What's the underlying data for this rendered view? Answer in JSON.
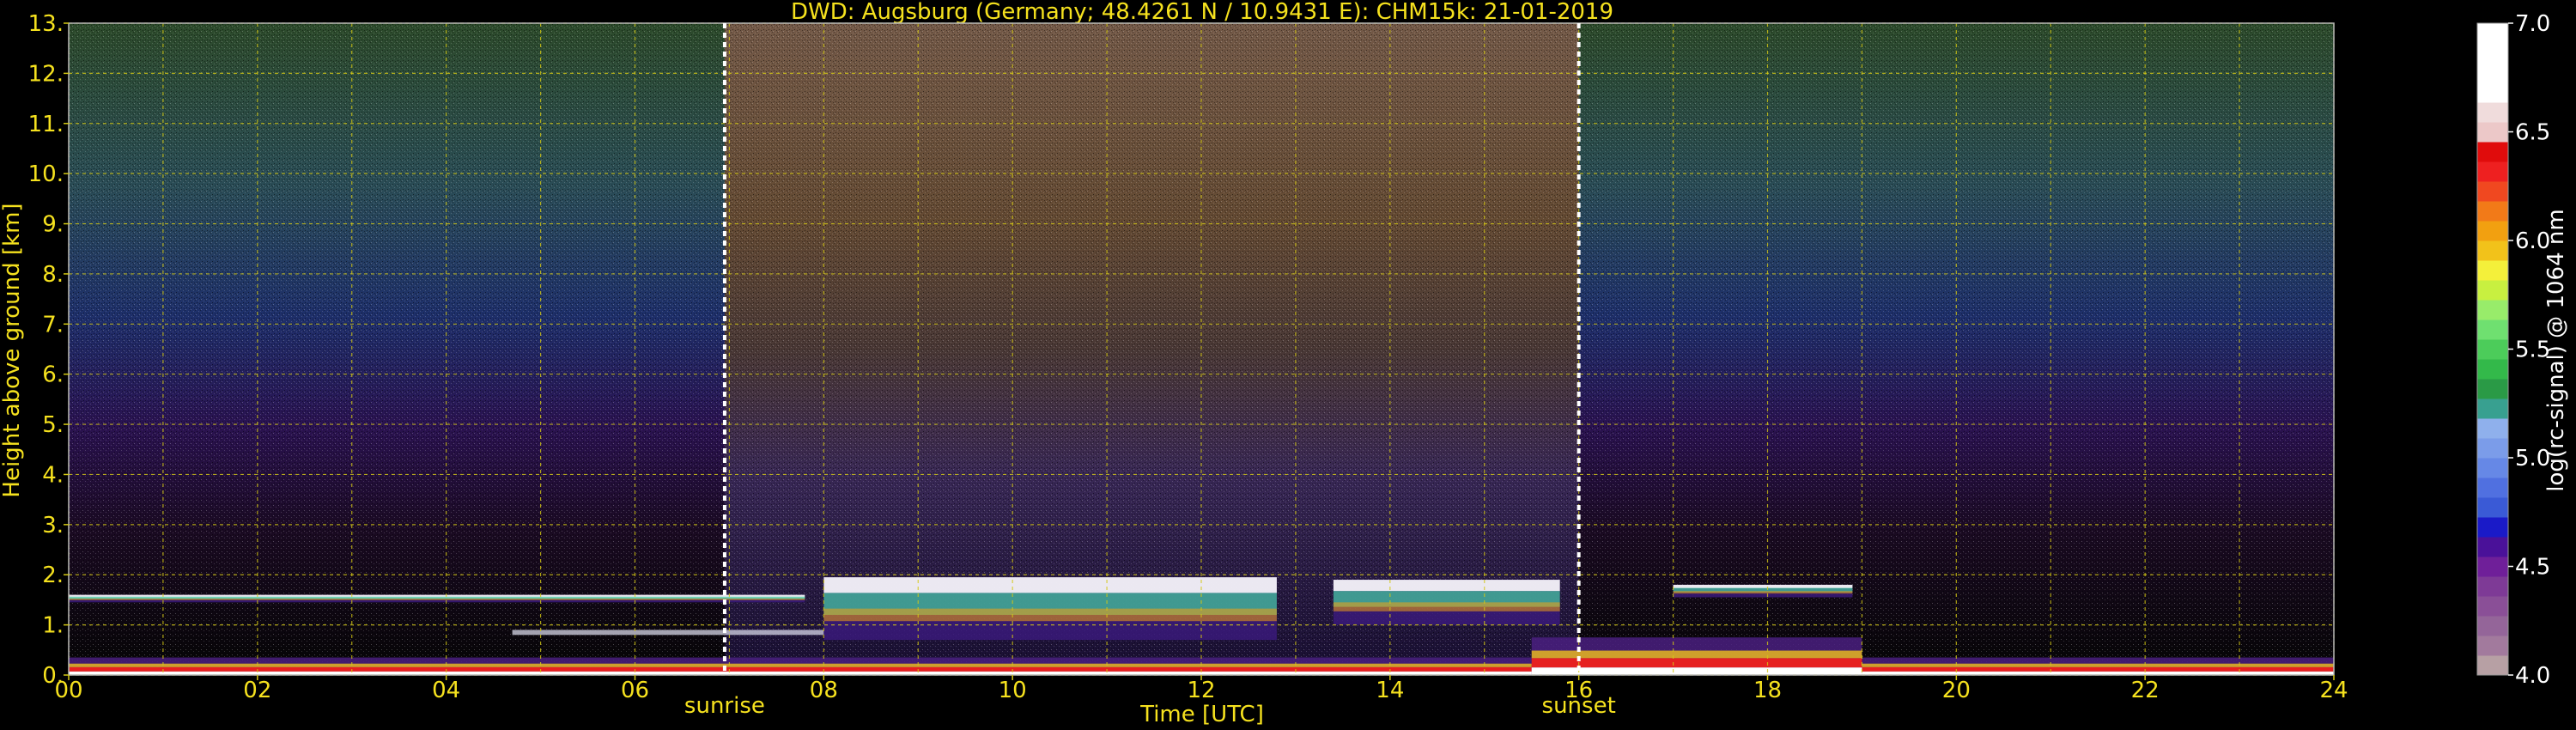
{
  "chart_data": {
    "type": "heatmap",
    "title": "DWD: Augsburg (Germany; 48.4261 N / 10.9431 E):    CHM15k: 21-01-2019",
    "xlabel": "Time [UTC]",
    "ylabel": "Height above ground [km]",
    "xlim": [
      0,
      24
    ],
    "ylim": [
      0,
      13
    ],
    "x_ticks": [
      "00",
      "02",
      "04",
      "06",
      "08",
      "10",
      "12",
      "14",
      "16",
      "18",
      "20",
      "22",
      "24"
    ],
    "y_ticks": [
      "0.",
      "1.",
      "2.",
      "3.",
      "4.",
      "5.",
      "6.",
      "7.",
      "8.",
      "9.",
      "10.",
      "11.",
      "12.",
      "13."
    ],
    "grid": true,
    "annotations": [
      {
        "label": "sunrise",
        "time": 6.95
      },
      {
        "label": "sunset",
        "time": 16.0
      }
    ],
    "colorbar": {
      "label": "log(rc-signal) @ 1064 nm",
      "range": [
        4.0,
        7.0
      ],
      "ticks": [
        "4.0",
        "4.5",
        "5.0",
        "5.5",
        "6.0",
        "6.5",
        "7.0"
      ],
      "colors": [
        "#b7a0a4",
        "#a27a9d",
        "#946599",
        "#8a4f97",
        "#7e3a96",
        "#6f1f99",
        "#4a1199",
        "#1a1ac8",
        "#3a5ad6",
        "#5070e0",
        "#6688e6",
        "#7b9ce9",
        "#8fb0ec",
        "#38a090",
        "#2a9a46",
        "#33b94a",
        "#4ccc5a",
        "#6fe070",
        "#98ec6a",
        "#c8f040",
        "#f4f03a",
        "#f2c21a",
        "#f2a010",
        "#f27a18",
        "#f04820",
        "#ee2020",
        "#e00c0c",
        "#ecc8c8",
        "#f0dcdc",
        "#ffffff",
        "#ffffff",
        "#ffffff",
        "#ffffff"
      ]
    },
    "features": [
      {
        "kind": "cloud_layer",
        "t_start": 0.0,
        "t_end": 7.8,
        "h_min_km": 1.45,
        "h_max_km": 1.6
      },
      {
        "kind": "aerosol_layer",
        "t_start": 4.7,
        "t_end": 8.0,
        "h_min_km": 0.8,
        "h_max_km": 0.9
      },
      {
        "kind": "cloud_layer",
        "t_start": 8.0,
        "t_end": 12.8,
        "h_min_km": 0.7,
        "h_max_km": 1.95
      },
      {
        "kind": "cloud_layer",
        "t_start": 13.4,
        "t_end": 15.8,
        "h_min_km": 1.0,
        "h_max_km": 1.9
      },
      {
        "kind": "cloud_layer",
        "t_start": 17.0,
        "t_end": 18.9,
        "h_min_km": 1.55,
        "h_max_km": 1.8
      },
      {
        "kind": "boundary_layer",
        "t_start": 0.0,
        "t_end": 24.0,
        "h_min_km": 0.0,
        "h_max_km": 0.35
      },
      {
        "kind": "boundary_layer",
        "t_start": 15.5,
        "t_end": 19.0,
        "h_min_km": 0.0,
        "h_max_km": 0.75
      }
    ]
  }
}
